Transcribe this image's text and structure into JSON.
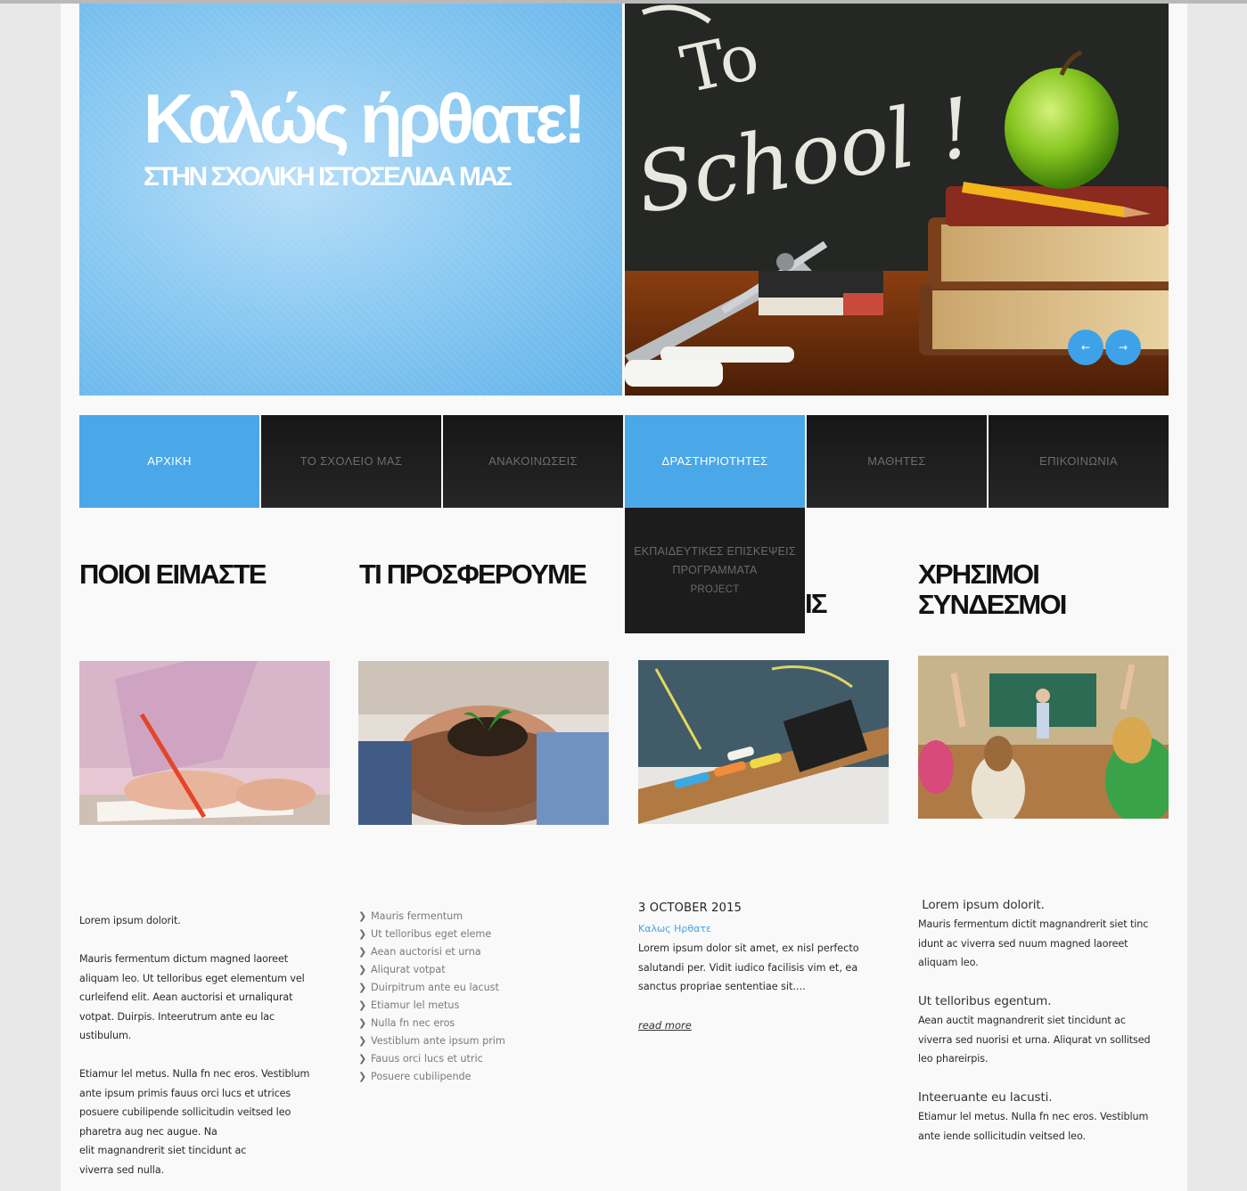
{
  "hero": {
    "title": "Καλώς ήρθατε!",
    "subtitle": "ΣΤΗΝ ΣΧΟΛΙΚΗ ΙΣΤΟΣΕΛΙΔΑ ΜΑΣ",
    "chalkboard_text_1": "To",
    "chalkboard_text_2": "School !",
    "prev_label": "←",
    "next_label": "→"
  },
  "nav": {
    "items": [
      {
        "label": "ΑΡΧΙΚΗ",
        "active": true
      },
      {
        "label": "ΤΟ ΣΧΟΛΕΙΟ ΜΑΣ",
        "active": false
      },
      {
        "label": "ΑΝΑΚΟΙΝΩΣΕΙΣ",
        "active": false
      },
      {
        "label": "ΔΡΑΣΤΗΡΙΟΤΗΤΕΣ",
        "active": true
      },
      {
        "label": "ΜΑΘΗΤΕΣ",
        "active": false
      },
      {
        "label": "ΕΠΙΚΟΙΝΩΝΙΑ",
        "active": false
      }
    ],
    "dropdown": [
      "ΕΚΠΑΙΔΕΥΤΙΚΕΣ ΕΠΙΣΚΕΨΕΙΣ",
      "ΠΡΟΓΡΑΜΜΑΤΑ",
      "PROJECT"
    ]
  },
  "columns": {
    "who": {
      "title": "ΠΟΙΟΙ ΕΙΜΑΣΤΕ",
      "paragraphs": [
        [
          "Lorem ipsum dolorit."
        ],
        [
          "Mauris fermentum dictum magned laoreet",
          "aliquam leo. Ut telloribus eget elementum vel",
          "curleifend elit. Aean auctorisi et urnaliqurat",
          "votpat. Duirpis. Inteerutrum ante eu lac",
          "ustibulum."
        ],
        [
          "Etiamur lel metus. Nulla fn nec eros. Vestiblum",
          "ante ipsum primis fauus orci lucs et utrices",
          "posuere cubilipende sollicitudin veitsed leo",
          "pharetra aug nec augue. Na",
          "elit magnandrerit siet tincidunt ac",
          "viverra sed nulla."
        ]
      ]
    },
    "offer": {
      "title": "ΤΙ ΠΡΟΣΦΕΡΟΥΜΕ",
      "items": [
        "Mauris fermentum",
        "Ut telloribus eget eleme",
        "Aean auctorisi et urna",
        "Aliqurat votpat",
        "Duirpitrum ante eu lacust",
        "Etiamur lel metus",
        "Nulla fn nec eros",
        "Vestiblum ante ipsum prim",
        "Fauus orci lucs et utric",
        "Posuere cubilipende"
      ]
    },
    "news": {
      "title_visible": "ΙΣ",
      "date": "3 OCTOBER 2015",
      "post_title": "Καλως Ηρθατε",
      "excerpt": [
        "Lorem ipsum dolor sit amet, ex nisl perfecto",
        "salutandi per. Vidit iudico facilisis vim et, ea",
        "sanctus propriae sententiae sit...."
      ],
      "read_more": "read more"
    },
    "links": {
      "title_line1": "ΧΡΗΣΙΜΟΙ",
      "title_line2": "ΣΥΝΔΕΣΜΟΙ",
      "blocks": [
        {
          "heading": " Lorem ipsum dolorit.",
          "lines": [
            "Mauris fermentum dictit magnandrerit siet tinc",
            "idunt ac viverra sed nuum magned laoreet",
            "aliquam leo."
          ]
        },
        {
          "heading": "Ut telloribus egentum.",
          "lines": [
            "Aean auctit magnandrerit siet tincidunt ac",
            "viverra sed nuorisi et urna. Aliqurat vn sollitsed",
            "leo phareirpis."
          ]
        },
        {
          "heading": "Inteeruante eu lacusti.",
          "lines": [
            "Etiamur lel metus. Nulla fn nec eros. Vestiblum",
            "ante iende sollicitudin veitsed leo."
          ]
        }
      ]
    }
  },
  "colors": {
    "accent": "#4aa7e8",
    "nav_dark": "#1d1d1d",
    "heading": "#111111",
    "link": "#4aa3e0"
  },
  "icons": {
    "list_bullet": "chevron-right-icon"
  }
}
